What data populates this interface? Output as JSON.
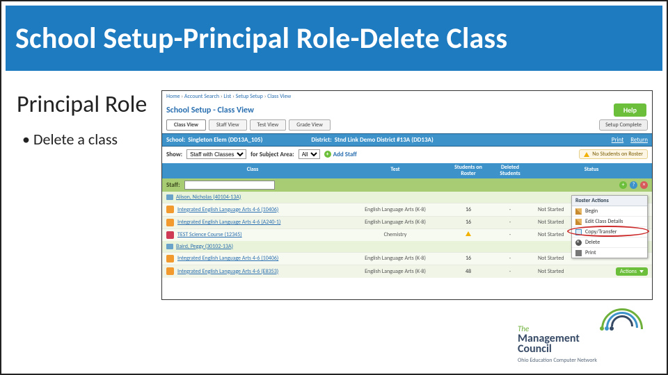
{
  "slide": {
    "title": "School Setup-Principal Role-Delete Class",
    "section": "Principal Role",
    "bullets": [
      "Delete a class"
    ]
  },
  "app": {
    "breadcrumb": [
      "Home",
      "Account Search",
      "List",
      "Setup Setup",
      "Class View"
    ],
    "page_title": "School Setup - Class View",
    "help_label": "Help",
    "tabs": [
      "Class View",
      "Staff View",
      "Test View",
      "Grade View"
    ],
    "active_tab": 0,
    "setup_complete_label": "Setup Complete",
    "bluebar": {
      "school_label": "School:",
      "school_value": "Singleton Elem (DD13A_105)",
      "district_label": "District:",
      "district_value": "Stnd Link Demo District #13A (DD13A)",
      "print": "Print",
      "return": "Return"
    },
    "showrow": {
      "show_label": "Show:",
      "show_value": "Staff with Classes",
      "for_label": "for Subject Area:",
      "subject_value": "All",
      "add_staff": "Add Staff",
      "warning": "No Students on Roster"
    },
    "columns": {
      "class": "Class",
      "test": "Test",
      "sor": "Students on Roster",
      "del": "Deleted Students",
      "status": "Status"
    },
    "staff_label": "Staff:",
    "groups": [
      {
        "staff": "Alison, Nicholas (40104-13A)",
        "rows": [
          {
            "icon": "orange",
            "class": "Integrated English Language Arts 4-6 (10406)",
            "test": "English Language Arts (K-8)",
            "sor": "16",
            "del": "-",
            "status": "Not Started",
            "action": true
          },
          {
            "icon": "orange",
            "class": "Integrated English Language Arts 4-6 (A240-1)",
            "test": "English Language Arts (K-8)",
            "sor": "16",
            "del": "-",
            "status": "Not Started",
            "action": false
          },
          {
            "icon": "red",
            "class": "TEST Science Course (12345)",
            "test": "Chemistry",
            "sor": "warn",
            "del": "-",
            "status": "Not Started",
            "action": false
          }
        ]
      },
      {
        "staff": "Baird, Peggy (30102-13A)",
        "rows": [
          {
            "icon": "orange",
            "class": "Integrated English Language Arts 4-6 (10406)",
            "test": "English Language Arts (K-8)",
            "sor": "16",
            "del": "-",
            "status": "Not Started",
            "action": false
          },
          {
            "icon": "orange",
            "class": "Integrated English Language Arts 4-6 (E8353)",
            "test": "English Language Arts (K-8)",
            "sor": "48",
            "del": "-",
            "status": "Not Started",
            "action": true
          }
        ]
      }
    ],
    "menu": {
      "header": "Roster Actions",
      "items": [
        "Begin",
        "Edit Class Details",
        "Copy/Transfer",
        "Delete",
        "Print"
      ]
    },
    "actions_label": "Actions"
  },
  "logo": {
    "the": "The",
    "line1": "Management",
    "line2": "Council",
    "tagline": "Ohio Education Computer Network"
  }
}
